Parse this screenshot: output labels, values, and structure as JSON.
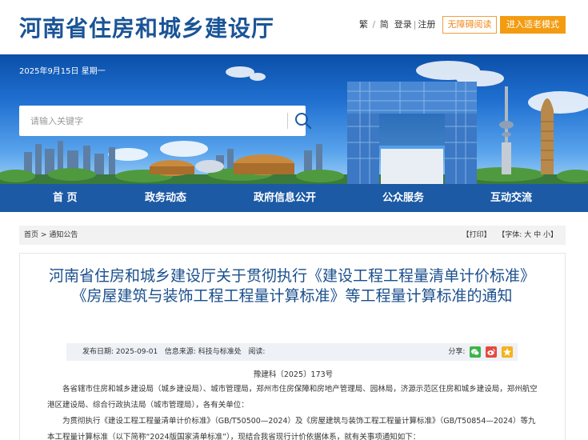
{
  "header": {
    "site_title": "河南省住房和城乡建设厅",
    "lang_trad": "繁",
    "lang_simp": "简",
    "login": "登录",
    "register": "注册",
    "accessible_btn": "无障碍阅读",
    "elder_btn": "进入适老模式"
  },
  "banner": {
    "date": "2025年9月15日 星期一",
    "search_placeholder": "请输入关键字"
  },
  "nav": {
    "items": [
      "首 页",
      "政务动态",
      "政府信息公开",
      "公众服务",
      "互动交流"
    ]
  },
  "breadcrumb": {
    "home": "首页",
    "separator": ">",
    "current": "通知公告",
    "print": "【打印】",
    "font_label": "【字体:",
    "font_large": "大",
    "font_medium": "中",
    "font_small": "小",
    "font_close": "】"
  },
  "article": {
    "title": "河南省住房和城乡建设厅关于贯彻执行《建设工程工程量清单计价标准》《房屋建筑与装饰工程工程量计算标准》等工程量计算标准的通知",
    "publish_label": "发布日期:",
    "publish_date": "2025-09-01",
    "source_label": "信息来源:",
    "source": "科技与标准处",
    "views_label": "阅读:",
    "share_label": "分享:",
    "doc_number": "豫建科〔2025〕173号",
    "paragraph1": "各省辖市住房和城乡建设局（城乡建设局）、城市管理局，郑州市住房保障和房地产管理局、园林局，济源示范区住房和城乡建设局，郑州航空港区建设局、综合行政执法局（城市管理局），各有关单位：",
    "paragraph2": "为贯彻执行《建设工程工程量清单计价标准》（GB/T50500—2024）及《房屋建筑与装饰工程工程量计算标准》（GB/T50854—2024）等九本工程量计算标准（以下简称“2024版国家清单标准”），现结合我省现行计价依据体系，就有关事项通知如下："
  },
  "colors": {
    "brand_blue": "#1a5496",
    "nav_blue": "#1c5aa5",
    "orange": "#f39c12",
    "title_blue": "#1a4f8c"
  }
}
